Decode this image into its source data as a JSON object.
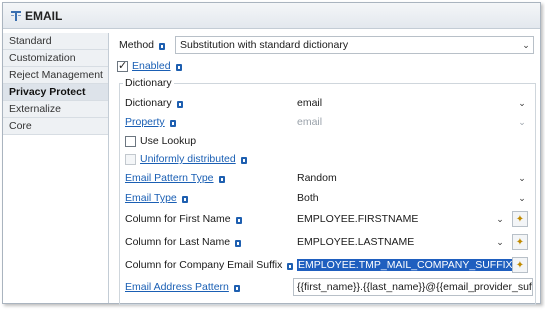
{
  "header": {
    "title": "EMAIL",
    "icon": "table-icon"
  },
  "sidebar": {
    "items": [
      {
        "label": "Standard"
      },
      {
        "label": "Customization"
      },
      {
        "label": "Reject Management"
      },
      {
        "label": "Privacy Protect"
      },
      {
        "label": "Externalize"
      },
      {
        "label": "Core"
      }
    ],
    "selected": "Privacy Protect"
  },
  "method": {
    "label": "Method",
    "value": "Substitution with standard dictionary"
  },
  "enabled": {
    "label": "Enabled",
    "checked": true
  },
  "dictionary_group": {
    "legend": "Dictionary",
    "dictionary": {
      "label": "Dictionary",
      "value": "email"
    },
    "property": {
      "label": "Property",
      "value": "email"
    },
    "use_lookup": {
      "label": "Use Lookup",
      "checked": false
    },
    "uniformly_distributed": {
      "label": "Uniformly distributed",
      "checked": false
    },
    "email_pattern_type": {
      "label": "Email Pattern Type",
      "value": "Random"
    },
    "email_type": {
      "label": "Email Type",
      "value": "Both"
    },
    "first_name_column": {
      "label": "Column for First Name",
      "value": "EMPLOYEE.FIRSTNAME"
    },
    "last_name_column": {
      "label": "Column for Last Name",
      "value": "EMPLOYEE.LASTNAME"
    },
    "company_suffix_column": {
      "label": "Column for Company Email Suffix",
      "value": "EMPLOYEE.TMP_MAIL_COMPANY_SUFFIX"
    },
    "email_address_pattern": {
      "label": "Email Address Pattern",
      "value": "{{first_name}}.{{last_name}}@{{email_provider_suffix}}"
    }
  },
  "colors": {
    "link": "#1a5fb4",
    "selection": "#1f5fbf",
    "info_icon": "#1e5fb0"
  }
}
